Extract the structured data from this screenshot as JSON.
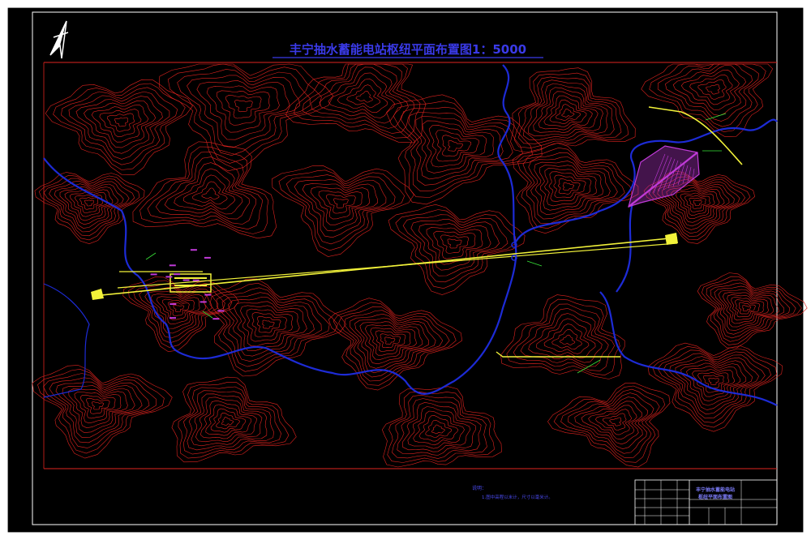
{
  "title": "丰宁抽水蓄能电站枢纽平面布置图1：5000",
  "colors": {
    "paper": "#ffffff",
    "canvas": "#000000",
    "frame": "#ffffff",
    "contour": "#e0231f",
    "river": "#1d2bd6",
    "alignment": "#f2f23a",
    "reservoir": "#c03ad8",
    "leader": "#39e639",
    "title": "#3a3ae8",
    "note": "#4a4af0",
    "table_title": "#7a7af5",
    "map_label": "#e03030"
  },
  "notes": {
    "heading": "说明：",
    "items": [
      "1.图中高程以米计，尺寸以毫米计。"
    ]
  },
  "title_block": {
    "project_name": "丰宁抽水蓄能电站",
    "drawing_name": "枢纽平面布置图"
  },
  "icons": {
    "north_arrow": "north-arrow-icon"
  }
}
